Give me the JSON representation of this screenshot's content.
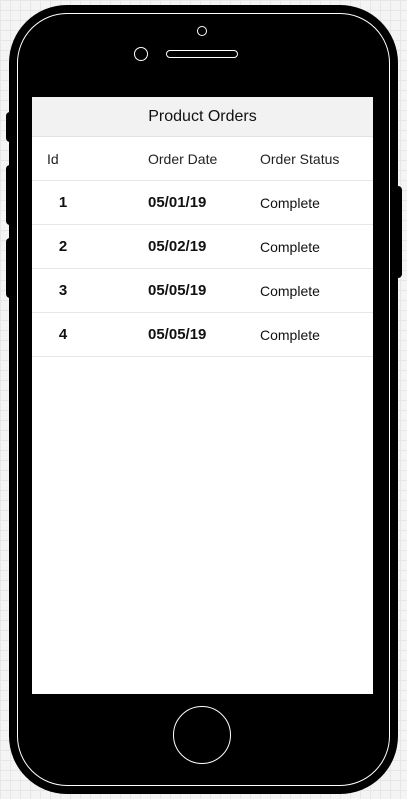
{
  "screen": {
    "title": "Product Orders"
  },
  "table": {
    "columns": {
      "id": "Id",
      "date": "Order Date",
      "status": "Order Status"
    },
    "rows": [
      {
        "id": "1",
        "date": "05/01/19",
        "status": "Complete"
      },
      {
        "id": "2",
        "date": "05/02/19",
        "status": "Complete"
      },
      {
        "id": "3",
        "date": "05/05/19",
        "status": "Complete"
      },
      {
        "id": "4",
        "date": "05/05/19",
        "status": "Complete"
      }
    ]
  },
  "colors": {
    "device": "#000000",
    "screen_background": "#ffffff",
    "navbar_background": "#f2f2f2",
    "row_divider": "#e8e8e8"
  }
}
